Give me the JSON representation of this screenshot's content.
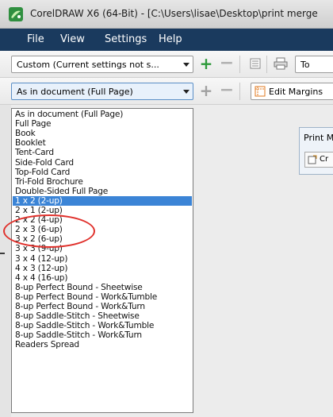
{
  "window": {
    "title": "CorelDRAW X6 (64-Bit) - [C:\\Users\\lisae\\Desktop\\print merge"
  },
  "menubar": {
    "items": [
      "File",
      "View",
      "Settings",
      "Help"
    ]
  },
  "toolbar1": {
    "preset_combo": "Custom (Current settings not s...",
    "to_label": "To"
  },
  "toolbar2": {
    "layout_combo": "As in document (Full Page)",
    "edit_margins_label": "Edit Margins"
  },
  "print_merge_panel": {
    "title": "Print M",
    "button_label": "Cr"
  },
  "dropdown": {
    "items": [
      "As in document (Full Page)",
      "Full Page",
      "Book",
      "Booklet",
      "Tent-Card",
      "Side-Fold Card",
      "Top-Fold Card",
      "Tri-Fold Brochure",
      "Double-Sided Full Page",
      "1 x 2 (2-up)",
      "2 x 1 (2-up)",
      "2 x 2 (4-up)",
      "2 x 3 (6-up)",
      "3 x 2 (6-up)",
      "3 x 3 (9-up)",
      "3 x 4 (12-up)",
      "4 x 3 (12-up)",
      "4 x 4 (16-up)",
      "8-up Perfect Bound - Sheetwise",
      "8-up Perfect Bound - Work&Tumble",
      "8-up Perfect Bound - Work&Turn",
      "8-up Saddle-Stitch - Sheetwise",
      "8-up Saddle-Stitch - Work&Tumble",
      "8-up Saddle-Stitch - Work&Turn",
      "Readers Spread"
    ],
    "selected_index": 9
  },
  "colors": {
    "menubar_bg": "#1a3a5e",
    "selection": "#3b84d6",
    "callout": "#e0302b",
    "plus_green": "#2d9a3a"
  }
}
